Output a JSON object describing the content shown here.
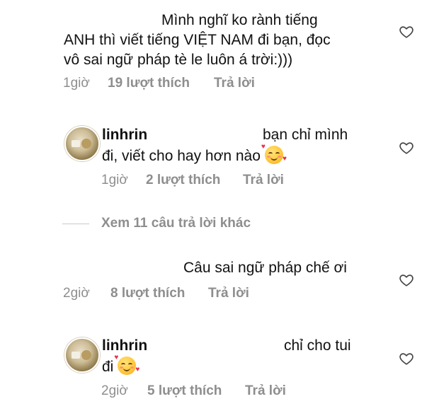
{
  "comments": [
    {
      "username": "",
      "text_lines": [
        "Mình nghĩ ko rành tiếng",
        "ANH thì viết tiếng VIỆT NAM đi bạn, đọc",
        "vô sai ngữ pháp tè le luôn á trời:)))"
      ],
      "time": "1giờ",
      "likes": "19 lượt thích",
      "reply": "Trả lời"
    },
    {
      "username": "linhrin",
      "text_lines": [
        "bạn chỉ mình",
        "đi, viết cho hay hơn nào"
      ],
      "emoji": "smiling-face-with-hearts",
      "time": "1giờ",
      "likes": "2 lượt thích",
      "reply": "Trả lời"
    },
    {
      "text_lines": [
        "Câu sai ngữ pháp chế ơi"
      ],
      "time": "2giờ",
      "likes": "8 lượt thích",
      "reply": "Trả lời"
    },
    {
      "username": "linhrin",
      "text_lines": [
        "chỉ cho tui",
        "đi"
      ],
      "emoji": "smiling-face-with-hearts",
      "time": "2giờ",
      "likes": "5 lượt thích",
      "reply": "Trả lời"
    }
  ],
  "view_more": "Xem 11 câu trả lời khác",
  "colors": {
    "text": "#111111",
    "meta": "#8e8e8e",
    "divider": "#c7c7c7"
  }
}
